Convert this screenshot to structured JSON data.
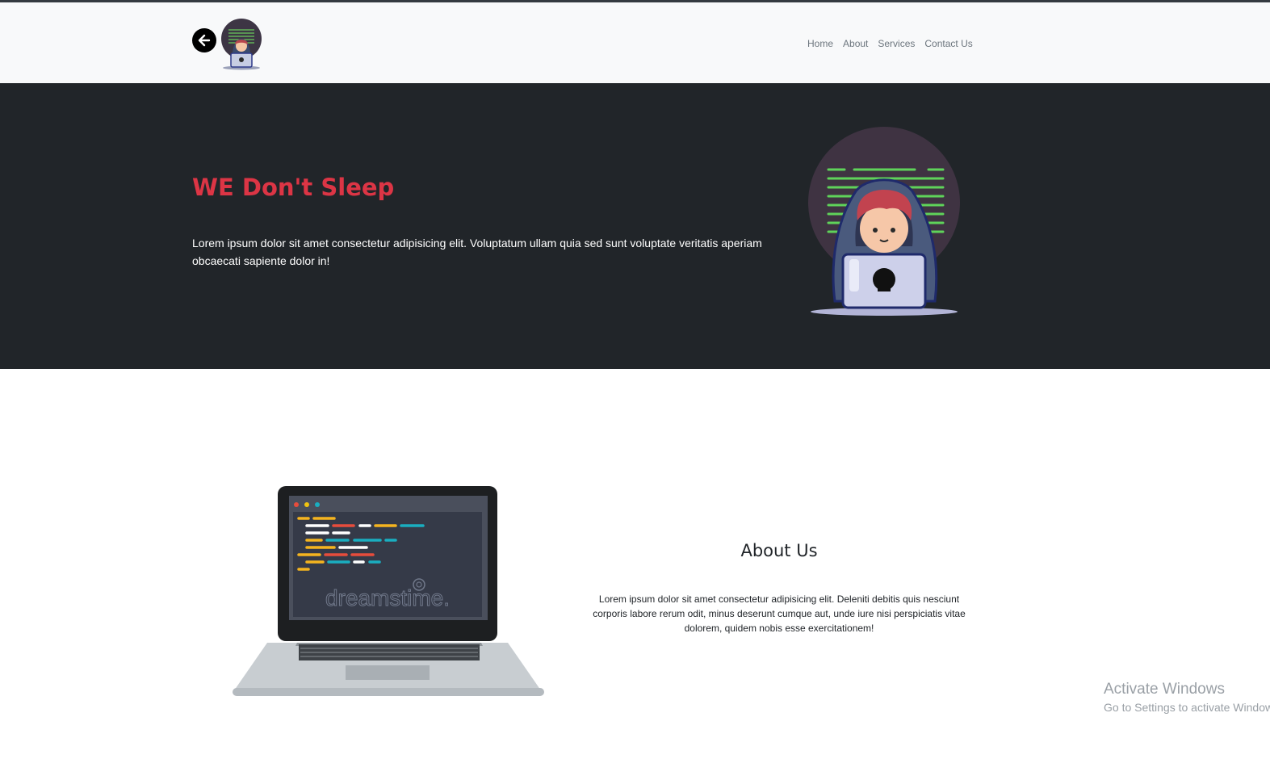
{
  "navbar": {
    "back_icon": "arrow-left-icon",
    "logo": "hacker-logo",
    "links": [
      "Home",
      "About",
      "Services",
      "Contact Us"
    ]
  },
  "hero": {
    "title": "WE Don't Sleep",
    "text": "Lorem ipsum dolor sit amet consectetur adipisicing elit. Voluptatum ullam quia sed sunt voluptate veritatis aperiam obcaecati sapiente dolor in!",
    "image": "hacker-illustration"
  },
  "about": {
    "image": "laptop-code-illustration",
    "watermark": "dreamstime.",
    "title": "About Us",
    "text": "Lorem ipsum dolor sit amet consectetur adipisicing elit. Deleniti debitis quis nesciunt corporis labore rerum odit, minus deserunt cumque aut, unde iure nisi perspiciatis vitae dolorem, quidem nobis esse exercitationem!"
  },
  "os_watermark": {
    "title": "Activate Windows",
    "subtitle": "Go to Settings to activate Windows."
  },
  "colors": {
    "navbar_bg": "#f8f9fa",
    "hero_bg": "#212529",
    "hero_title": "#dc3545",
    "code_green": "#5fd35a"
  }
}
